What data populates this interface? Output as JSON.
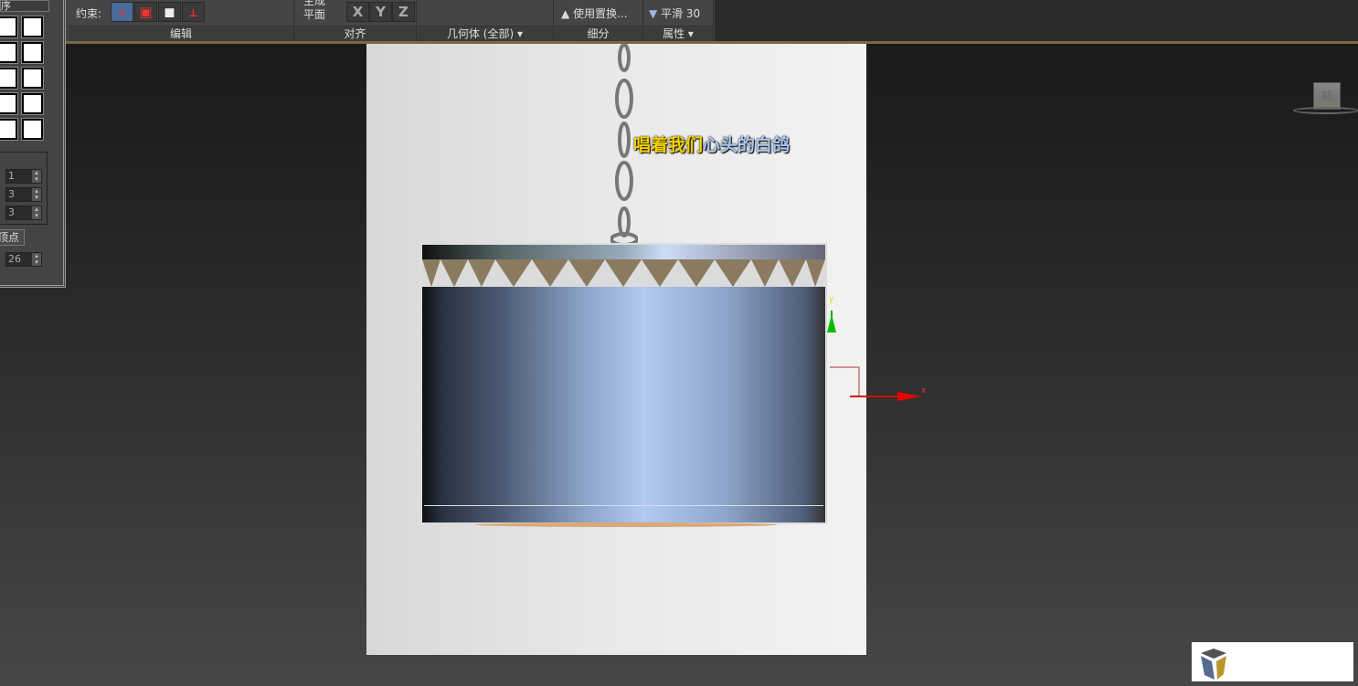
{
  "ribbon": {
    "constraint_label": "约束:",
    "generate_plane": [
      "生成",
      "平面"
    ],
    "axes": [
      "X",
      "Y",
      "Z"
    ],
    "use_displace": "使用置换...",
    "smooth": "平滑 30",
    "smooth_icon_num": "30",
    "sections": {
      "edit": "编辑",
      "align": "对齐",
      "geometry": "几何体 (全部)",
      "subdivide": "细分",
      "properties": "属性"
    }
  },
  "left_panel": {
    "header": "序",
    "spinners": [
      "1",
      "3",
      "3"
    ],
    "vertex_button": "顶点",
    "bottom_spinner": "26"
  },
  "viewport": {
    "subtitle_part1": "唱着我们",
    "subtitle_part2": "心头的白鸽",
    "gizmo_x": "x",
    "gizmo_y": "y",
    "viewcube_label": "前"
  },
  "colors": {
    "accent": "#4a6b9a",
    "subtitle_yellow": "#f0d000",
    "subtitle_blue": "#a9c8f0"
  }
}
